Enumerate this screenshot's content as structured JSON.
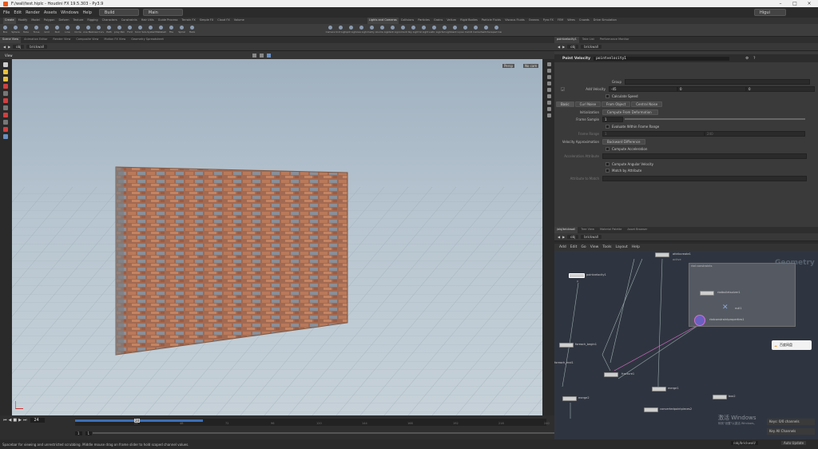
{
  "window": {
    "title": "F:/wall/test.hiplc - Houdini FX 19.5.303 - Py3.9"
  },
  "menu": {
    "items": [
      "File",
      "Edit",
      "Render",
      "Assets",
      "Windows",
      "Help"
    ],
    "desktop": "Build",
    "context": "Main",
    "mode": "Higui"
  },
  "shelf": {
    "tabs_left": [
      "Create",
      "Modify",
      "Model",
      "Polygon",
      "Deform",
      "Texture",
      "Rigging",
      "Characters",
      "Constraints",
      "Hair Utils",
      "Guide Process",
      "Terrain FX",
      "Simple FX",
      "Cloud FX",
      "Volume"
    ],
    "tabs_right": [
      "Lights and Cameras",
      "Collisions",
      "Particles",
      "Grains",
      "Vellum",
      "Rigid Bodies",
      "Particle Fluids",
      "Viscous Fluids",
      "Oceans",
      "Pyro FX",
      "FEM",
      "Wires",
      "Crowds",
      "Drive Simulation"
    ],
    "tools_left": [
      "Box",
      "Sphere",
      "Tube",
      "Torus",
      "Grid",
      "Null",
      "Line",
      "Circle",
      "Curve Bezier",
      "Draw Curve",
      "Path",
      "Spray Paint",
      "Font",
      "Platonic Solids",
      "L-System",
      "Metaball",
      "File",
      "Spiral",
      "Helix"
    ],
    "tools_right": [
      "Camera",
      "Point Light",
      "Spot Light",
      "Area Light",
      "Geometry Light",
      "Volume Light",
      "Distant Light",
      "Environment Light",
      "Sky Light",
      "GI Light",
      "Caustic Light",
      "Portal Light",
      "Ambient Light",
      "Stereo Camera",
      "VR Camera",
      "Switcher",
      "Gamepad Camera"
    ]
  },
  "viewer": {
    "pane_tabs": [
      "Scene View",
      "Animation Editor",
      "Render View",
      "Composite View",
      "Motion FX View",
      "Geometry Spreadsheet"
    ],
    "path": [
      "obj",
      "brickwall"
    ],
    "view_label": "View",
    "persp": "Persp",
    "cam": "No cam"
  },
  "params": {
    "pane_tabs": [
      "pointvelocity1",
      "Take List",
      "Performance Monitor"
    ],
    "path": [
      "obj",
      "brickwall"
    ],
    "node_type": "Point Velocity",
    "node_name": "pointvelocity1",
    "group_label": "Group",
    "add_velocity_label": "Add Velocity",
    "add_velocity_values": [
      "-45",
      "0",
      "0"
    ],
    "calculate_speed": "Calculate Speed",
    "tabs": [
      "Basic",
      "Curl Noise",
      "From Object",
      "Central Noise"
    ],
    "initialization_label": "Initialization",
    "initialization_value": "Compute From Deformation",
    "frame_sample_label": "Frame Sample",
    "frame_sample_value": "1",
    "evaluate_within_range": "Evaluate Within Frame Range",
    "frame_range_label": "Frame Range",
    "frame_range_values": [
      "1",
      "240"
    ],
    "velocity_approx_label": "Velocity Approximation",
    "velocity_approx_value": "Backward Difference",
    "compute_acceleration": "Compute Acceleration",
    "acceleration_attr_label": "Acceleration Attribute",
    "compute_angular": "Compute Angular Velocity",
    "match_by_attr": "Match by Attribute",
    "attr_to_match_label": "Attribute to Match"
  },
  "network": {
    "pane_tabs": [
      "/obj/brickwall",
      "Tree View",
      "Material Palette",
      "Asset Browser"
    ],
    "path": [
      "obj",
      "brickwall"
    ],
    "menu": [
      "Add",
      "Edit",
      "Go",
      "View",
      "Tools",
      "Layout",
      "Help"
    ],
    "watermark": "Geometry",
    "nodes": [
      "attribcreate1",
      "pointvelocity1",
      "rbdbulletsolver1",
      "null1",
      "rbdconstraintproperties1",
      "foreach_begin1",
      "fracture1",
      "merge1",
      "merge2",
      "convertedpointpieces2",
      "box2",
      "foreach_end1"
    ],
    "sublabels": [
      "active",
      "p"
    ],
    "netbox_title": "rbd constraints"
  },
  "timeline": {
    "frame": "24",
    "current_marker": "24",
    "ticks": [
      "24",
      "48",
      "72",
      "96",
      "120",
      "144",
      "168",
      "192",
      "216",
      "240"
    ],
    "start": "1",
    "start2": "1",
    "end": "240",
    "end2": "240",
    "keys_label": "Keys: 0/0 channels",
    "key_all": "Key All Channels"
  },
  "status": {
    "message": "Spacebar for viewing and unrestricted scrubbing. Middle mouse drag on frame slider to hold scoped channel values.",
    "path": "/obj/brickwall/",
    "autoupdate": "Auto Update"
  },
  "overlay": {
    "windows_activate": "激活 Windows",
    "windows_activate_sub": "转到\"设置\"以激活 Windows。",
    "baidu": "百度网盘"
  },
  "colors": {
    "accent_blue": "#3b6fb6",
    "brick": "#b06a4a",
    "node_yellow": "#e7d24a",
    "selection_pink": "#d44bd6"
  }
}
